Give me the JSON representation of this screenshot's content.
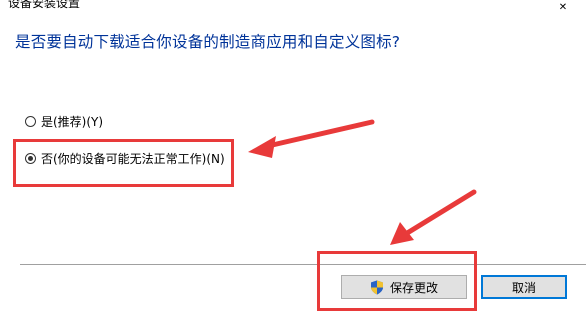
{
  "window": {
    "title": "设备安装设置",
    "close_symbol": "✕"
  },
  "dialog": {
    "question": "是否要自动下载适合你设备的制造商应用和自定义图标?",
    "options": [
      {
        "label": "是(推荐)(Y)",
        "selected": false
      },
      {
        "label": "否(你的设备可能无法正常工作)(N)",
        "selected": true
      }
    ]
  },
  "buttons": {
    "save_label": "保存更改",
    "cancel_label": "取消"
  },
  "colors": {
    "heading": "#003399",
    "annotation": "#e83a3a",
    "default_button_border": "#0078d7"
  },
  "icons": {
    "save_button_icon": "uac-shield-icon"
  }
}
